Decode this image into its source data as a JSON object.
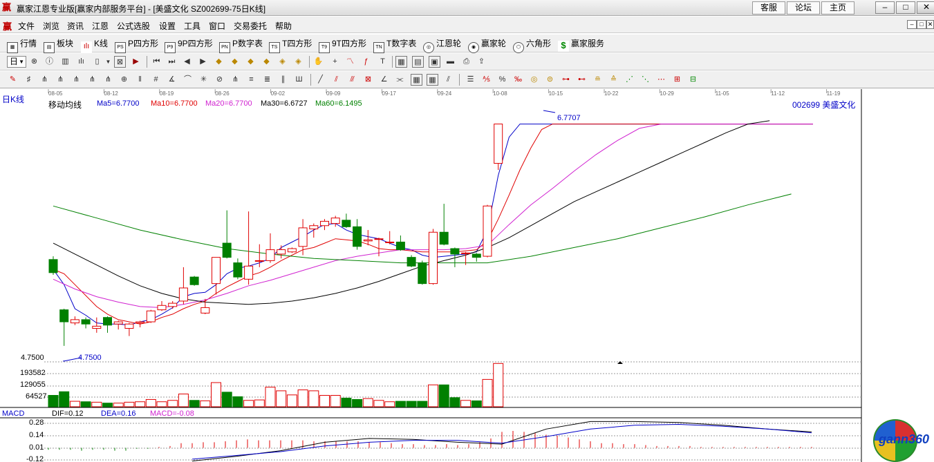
{
  "app": {
    "title": "赢家江恩专业版[赢家内部服务平台] - [美盛文化  SZ002699-75日K线]",
    "links": [
      "客服",
      "论坛",
      "主页"
    ],
    "window_buttons": [
      "–",
      "□",
      "✕"
    ]
  },
  "menu": {
    "items": [
      "文件",
      "浏览",
      "资讯",
      "江恩",
      "公式选股",
      "设置",
      "工具",
      "窗口",
      "交易委托",
      "帮助"
    ],
    "mdi_buttons": [
      "–",
      "□",
      "✕"
    ]
  },
  "toolbar1": {
    "items": [
      {
        "label": "行情",
        "icon": "quote-icon"
      },
      {
        "label": "板块",
        "icon": "sector-icon"
      },
      {
        "label": "K线",
        "icon": "kline-icon"
      },
      {
        "label": "P四方形",
        "icon": "p-square-icon",
        "badge": "PS"
      },
      {
        "label": "9P四方形",
        "icon": "9p-square-icon",
        "badge": "P9"
      },
      {
        "label": "P数字表",
        "icon": "p-table-icon",
        "badge": "PN"
      },
      {
        "label": "T四方形",
        "icon": "t-square-icon",
        "badge": "TS"
      },
      {
        "label": "9T四方形",
        "icon": "9t-square-icon",
        "badge": "T9"
      },
      {
        "label": "T数字表",
        "icon": "t-table-icon",
        "badge": "TN"
      },
      {
        "label": "江恩轮",
        "icon": "gann-wheel-icon"
      },
      {
        "label": "赢家轮",
        "icon": "winner-wheel-icon"
      },
      {
        "label": "六角形",
        "icon": "hexagon-icon"
      },
      {
        "label": "赢家服务",
        "icon": "dollar-icon"
      }
    ]
  },
  "period_selector": {
    "value": "日"
  },
  "chart_header": {
    "period_label": "日K线",
    "indicator_name": "移动均线",
    "ma": [
      {
        "label": "Ma5=6.7700",
        "color": "#0000c8"
      },
      {
        "label": "Ma10=6.7700",
        "color": "#e00000"
      },
      {
        "label": "Ma20=6.7700",
        "color": "#d020d0"
      },
      {
        "label": "Ma30=6.6727",
        "color": "#000000"
      },
      {
        "label": "Ma60=6.1495",
        "color": "#008000"
      }
    ],
    "stock": "002699  美盛文化"
  },
  "date_axis": [
    "08-05",
    "08-12",
    "08-19",
    "08-26",
    "09-02",
    "09-09",
    "09-17",
    "09-24",
    "10-08",
    "10-15",
    "10-22",
    "10-29",
    "11-05",
    "11-12",
    "11-19"
  ],
  "price_annotations": {
    "high_label": "6.7707",
    "low_label": "4.7500",
    "low_axis": "4.7500"
  },
  "volume_axis": [
    "193582",
    "129055",
    "64527"
  ],
  "macd": {
    "title": "MACD",
    "dif": "DIF=0.12",
    "dea": "DEA=0.16",
    "macd": "MACD=-0.08",
    "axis": [
      "0.28",
      "0.14",
      "0.01",
      "-0.12"
    ]
  },
  "watermark": "gann360",
  "colors": {
    "up": "#e00000",
    "down": "#008000",
    "ma5": "#0000c8",
    "ma10": "#e00000",
    "ma20": "#d020d0",
    "ma30": "#000000",
    "ma60": "#008000"
  },
  "chart_data": {
    "type": "candlestick",
    "price": {
      "ylim": [
        4.6,
        6.9
      ]
    },
    "candles": [
      {
        "o": 5.53,
        "c": 5.41,
        "h": 5.56,
        "l": 5.39
      },
      {
        "o": 5.07,
        "c": 4.96,
        "h": 5.08,
        "l": 4.74
      },
      {
        "o": 4.95,
        "c": 4.98,
        "h": 5.01,
        "l": 4.93
      },
      {
        "o": 4.98,
        "c": 4.94,
        "h": 5.0,
        "l": 4.9
      },
      {
        "o": 4.9,
        "c": 4.92,
        "h": 5.0,
        "l": 4.86
      },
      {
        "o": 5.0,
        "c": 4.93,
        "h": 5.01,
        "l": 4.86
      },
      {
        "o": 4.94,
        "c": 4.96,
        "h": 4.97,
        "l": 4.89
      },
      {
        "o": 4.9,
        "c": 4.94,
        "h": 4.95,
        "l": 4.83
      },
      {
        "o": 4.95,
        "c": 4.96,
        "h": 4.97,
        "l": 4.91
      },
      {
        "o": 4.96,
        "c": 5.06,
        "h": 5.07,
        "l": 4.95
      },
      {
        "o": 5.07,
        "c": 5.11,
        "h": 5.15,
        "l": 5.06
      },
      {
        "o": 5.1,
        "c": 5.13,
        "h": 5.15,
        "l": 5.08
      },
      {
        "o": 5.15,
        "c": 5.27,
        "h": 5.46,
        "l": 5.12
      },
      {
        "o": 5.37,
        "c": 5.3,
        "h": 5.38,
        "l": 5.29
      },
      {
        "o": 5.04,
        "c": 5.09,
        "h": 5.17,
        "l": 5.03
      },
      {
        "o": 5.31,
        "c": 5.55,
        "h": 5.55,
        "l": 5.21
      },
      {
        "o": 5.68,
        "c": 5.55,
        "h": 5.98,
        "l": 5.54
      },
      {
        "o": 5.5,
        "c": 5.37,
        "h": 5.54,
        "l": 5.35
      },
      {
        "o": 5.35,
        "c": 5.47,
        "h": 5.97,
        "l": 5.3
      },
      {
        "o": 5.52,
        "c": 5.52,
        "h": 5.67,
        "l": 5.46
      },
      {
        "o": 5.52,
        "c": 5.62,
        "h": 5.77,
        "l": 5.5
      },
      {
        "o": 5.58,
        "c": 5.62,
        "h": 5.66,
        "l": 5.54
      },
      {
        "o": 5.6,
        "c": 5.63,
        "h": 5.64,
        "l": 5.59
      },
      {
        "o": 5.65,
        "c": 5.82,
        "h": 5.9,
        "l": 5.57
      },
      {
        "o": 5.81,
        "c": 5.84,
        "h": 5.86,
        "l": 5.73
      },
      {
        "o": 5.84,
        "c": 5.88,
        "h": 5.9,
        "l": 5.8
      },
      {
        "o": 5.86,
        "c": 5.91,
        "h": 5.93,
        "l": 5.83
      },
      {
        "o": 5.89,
        "c": 5.83,
        "h": 5.95,
        "l": 5.82
      },
      {
        "o": 5.83,
        "c": 5.65,
        "h": 5.9,
        "l": 5.62
      },
      {
        "o": 5.7,
        "c": 5.71,
        "h": 5.8,
        "l": 5.66
      },
      {
        "o": 5.72,
        "c": 5.72,
        "h": 5.73,
        "l": 5.56
      },
      {
        "o": 5.69,
        "c": 5.69,
        "h": 5.79,
        "l": 5.67
      },
      {
        "o": 5.69,
        "c": 5.62,
        "h": 5.75,
        "l": 5.61
      },
      {
        "o": 5.55,
        "c": 5.47,
        "h": 5.57,
        "l": 5.46
      },
      {
        "o": 5.5,
        "c": 5.31,
        "h": 5.52,
        "l": 5.3
      },
      {
        "o": 5.31,
        "c": 5.78,
        "h": 5.81,
        "l": 5.3
      },
      {
        "o": 5.78,
        "c": 5.67,
        "h": 6.04,
        "l": 5.66
      },
      {
        "o": 5.63,
        "c": 5.58,
        "h": 5.64,
        "l": 5.46
      },
      {
        "o": 5.59,
        "c": 5.59,
        "h": 5.6,
        "l": 5.48
      },
      {
        "o": 5.58,
        "c": 5.55,
        "h": 5.59,
        "l": 5.51
      },
      {
        "o": 5.56,
        "c": 6.02,
        "h": 6.03,
        "l": 5.55
      },
      {
        "o": 6.41,
        "c": 6.77,
        "h": 6.77,
        "l": 6.35
      }
    ],
    "volume": [
      0.25,
      0.33,
      0.12,
      0.11,
      0.1,
      0.08,
      0.08,
      0.1,
      0.11,
      0.16,
      0.11,
      0.14,
      0.28,
      0.14,
      0.13,
      0.53,
      0.32,
      0.22,
      0.14,
      0.15,
      0.43,
      0.35,
      0.26,
      0.37,
      0.35,
      0.25,
      0.25,
      0.19,
      0.16,
      0.18,
      0.14,
      0.11,
      0.12,
      0.12,
      0.12,
      0.48,
      0.48,
      0.2,
      0.14,
      0.13,
      0.6,
      0.95
    ],
    "volume_scale": 203000,
    "ma_lines": {
      "ma5": [
        [
          0,
          5.44
        ],
        [
          1,
          5.3
        ],
        [
          2,
          5.08
        ],
        [
          3,
          5.02
        ],
        [
          4,
          4.95
        ],
        [
          5,
          4.94
        ],
        [
          6,
          4.94
        ],
        [
          7,
          4.93
        ],
        [
          8,
          4.96
        ],
        [
          9,
          4.98
        ],
        [
          10,
          5.03
        ],
        [
          11,
          5.09
        ],
        [
          12,
          5.19
        ],
        [
          13,
          5.22
        ],
        [
          14,
          5.23
        ],
        [
          15,
          5.3
        ],
        [
          16,
          5.4
        ],
        [
          17,
          5.45
        ],
        [
          18,
          5.47
        ],
        [
          19,
          5.5
        ],
        [
          20,
          5.54
        ],
        [
          21,
          5.64
        ],
        [
          22,
          5.69
        ],
        [
          23,
          5.74
        ],
        [
          24,
          5.8
        ],
        [
          25,
          5.85
        ],
        [
          26,
          5.86
        ],
        [
          27,
          5.8
        ],
        [
          28,
          5.76
        ],
        [
          29,
          5.74
        ],
        [
          30,
          5.72
        ],
        [
          31,
          5.68
        ],
        [
          32,
          5.64
        ],
        [
          33,
          5.62
        ],
        [
          34,
          5.57
        ],
        [
          35,
          5.55
        ],
        [
          36,
          5.56
        ],
        [
          37,
          5.57
        ],
        [
          38,
          5.58
        ],
        [
          39,
          5.6
        ],
        [
          40,
          5.8
        ],
        [
          41,
          6.3
        ],
        [
          42,
          6.65
        ],
        [
          43,
          6.77
        ],
        [
          44,
          6.77
        ],
        [
          70,
          6.77
        ]
      ],
      "ma10": [
        [
          0,
          5.44
        ],
        [
          1,
          5.4
        ],
        [
          2,
          5.3
        ],
        [
          3,
          5.2
        ],
        [
          4,
          5.1
        ],
        [
          5,
          5.03
        ],
        [
          6,
          4.98
        ],
        [
          7,
          4.96
        ],
        [
          8,
          4.94
        ],
        [
          9,
          4.96
        ],
        [
          10,
          5.0
        ],
        [
          11,
          5.03
        ],
        [
          12,
          5.08
        ],
        [
          13,
          5.12
        ],
        [
          14,
          5.15
        ],
        [
          15,
          5.22
        ],
        [
          16,
          5.28
        ],
        [
          17,
          5.33
        ],
        [
          18,
          5.38
        ],
        [
          19,
          5.41
        ],
        [
          20,
          5.46
        ],
        [
          21,
          5.52
        ],
        [
          22,
          5.57
        ],
        [
          23,
          5.62
        ],
        [
          24,
          5.64
        ],
        [
          25,
          5.68
        ],
        [
          26,
          5.72
        ],
        [
          27,
          5.71
        ],
        [
          28,
          5.7
        ],
        [
          29,
          5.67
        ],
        [
          30,
          5.63
        ],
        [
          31,
          5.62
        ],
        [
          32,
          5.62
        ],
        [
          33,
          5.61
        ],
        [
          34,
          5.6
        ],
        [
          35,
          5.6
        ],
        [
          36,
          5.6
        ],
        [
          37,
          5.6
        ],
        [
          38,
          5.61
        ],
        [
          39,
          5.62
        ],
        [
          40,
          5.7
        ],
        [
          41,
          5.9
        ],
        [
          42,
          6.12
        ],
        [
          43,
          6.35
        ],
        [
          44,
          6.55
        ],
        [
          45,
          6.72
        ],
        [
          46,
          6.77
        ],
        [
          70,
          6.77
        ]
      ],
      "ma20": [
        [
          0,
          5.35
        ],
        [
          2,
          5.26
        ],
        [
          4,
          5.19
        ],
        [
          6,
          5.14
        ],
        [
          8,
          5.1
        ],
        [
          10,
          5.09
        ],
        [
          12,
          5.12
        ],
        [
          14,
          5.16
        ],
        [
          16,
          5.22
        ],
        [
          18,
          5.29
        ],
        [
          20,
          5.34
        ],
        [
          22,
          5.4
        ],
        [
          24,
          5.46
        ],
        [
          26,
          5.52
        ],
        [
          28,
          5.56
        ],
        [
          30,
          5.59
        ],
        [
          32,
          5.62
        ],
        [
          34,
          5.62
        ],
        [
          36,
          5.62
        ],
        [
          38,
          5.63
        ],
        [
          40,
          5.66
        ],
        [
          42,
          5.85
        ],
        [
          44,
          6.03
        ],
        [
          46,
          6.18
        ],
        [
          48,
          6.34
        ],
        [
          50,
          6.49
        ],
        [
          52,
          6.62
        ],
        [
          54,
          6.73
        ],
        [
          56,
          6.77
        ],
        [
          70,
          6.77
        ]
      ],
      "ma30": [
        [
          0,
          5.68
        ],
        [
          2,
          5.58
        ],
        [
          4,
          5.48
        ],
        [
          6,
          5.38
        ],
        [
          8,
          5.29
        ],
        [
          10,
          5.22
        ],
        [
          12,
          5.17
        ],
        [
          14,
          5.14
        ],
        [
          16,
          5.13
        ],
        [
          18,
          5.12
        ],
        [
          20,
          5.13
        ],
        [
          22,
          5.15
        ],
        [
          24,
          5.18
        ],
        [
          26,
          5.22
        ],
        [
          28,
          5.27
        ],
        [
          30,
          5.33
        ],
        [
          32,
          5.4
        ],
        [
          34,
          5.47
        ],
        [
          36,
          5.52
        ],
        [
          38,
          5.57
        ],
        [
          40,
          5.64
        ],
        [
          42,
          5.73
        ],
        [
          44,
          5.84
        ],
        [
          46,
          5.95
        ],
        [
          48,
          6.06
        ],
        [
          50,
          6.15
        ],
        [
          52,
          6.24
        ],
        [
          54,
          6.33
        ],
        [
          56,
          6.42
        ],
        [
          58,
          6.51
        ],
        [
          60,
          6.6
        ],
        [
          62,
          6.69
        ],
        [
          64,
          6.77
        ],
        [
          66,
          6.8
        ]
      ],
      "ma60": [
        [
          0,
          6.02
        ],
        [
          4,
          5.91
        ],
        [
          8,
          5.8
        ],
        [
          12,
          5.71
        ],
        [
          16,
          5.63
        ],
        [
          20,
          5.58
        ],
        [
          24,
          5.54
        ],
        [
          28,
          5.52
        ],
        [
          32,
          5.5
        ],
        [
          36,
          5.5
        ],
        [
          40,
          5.5
        ],
        [
          44,
          5.56
        ],
        [
          48,
          5.64
        ],
        [
          52,
          5.72
        ],
        [
          56,
          5.82
        ],
        [
          60,
          5.92
        ],
        [
          64,
          6.03
        ],
        [
          68,
          6.13
        ]
      ]
    },
    "macd_series": {
      "ylim": [
        -0.15,
        0.29
      ],
      "dif": [
        [
          13,
          -0.14
        ],
        [
          17,
          -0.09
        ],
        [
          21,
          -0.03
        ],
        [
          25,
          0.06
        ],
        [
          29,
          0.1
        ],
        [
          33,
          0.09
        ],
        [
          37,
          0.06
        ],
        [
          41,
          0.04
        ],
        [
          45,
          0.2
        ],
        [
          49,
          0.28
        ],
        [
          53,
          0.28
        ],
        [
          57,
          0.27
        ],
        [
          61,
          0.24
        ],
        [
          65,
          0.2
        ],
        [
          69,
          0.17
        ]
      ],
      "dea": [
        [
          13,
          -0.12
        ],
        [
          17,
          -0.08
        ],
        [
          21,
          -0.04
        ],
        [
          25,
          0.02
        ],
        [
          29,
          0.06
        ],
        [
          33,
          0.08
        ],
        [
          37,
          0.08
        ],
        [
          41,
          0.05
        ],
        [
          45,
          0.12
        ],
        [
          49,
          0.2
        ],
        [
          53,
          0.24
        ],
        [
          57,
          0.25
        ],
        [
          61,
          0.23
        ],
        [
          65,
          0.2
        ],
        [
          69,
          0.16
        ]
      ],
      "hist": [
        -0.02,
        -0.02,
        -0.02,
        -0.03,
        -0.02,
        -0.02,
        -0.03,
        -0.03,
        -0.01,
        -0.01,
        0.01,
        0.02,
        0.05,
        0.05,
        0.06,
        0.06,
        0.07,
        0.08,
        0.09,
        0.08,
        0.08,
        0.08,
        0.08,
        0.08,
        0.07,
        0.07,
        0.07,
        0.07,
        0.07,
        0.06,
        0.06,
        0.05,
        0.04,
        0.04,
        0.03,
        0.03,
        0.04,
        0.03,
        0.04,
        0.06,
        0.1,
        0.17,
        0.18,
        0.17,
        0.16,
        0.14,
        0.13,
        0.11,
        0.09,
        0.07,
        0.05,
        0.05,
        0.04,
        0.04,
        0.03,
        0.02,
        0.02,
        0.02,
        0.02,
        0.01,
        0.01,
        0.01,
        0.01,
        0.01,
        0.01,
        0.01,
        0.01,
        0.01,
        0.01,
        0.01
      ]
    }
  }
}
